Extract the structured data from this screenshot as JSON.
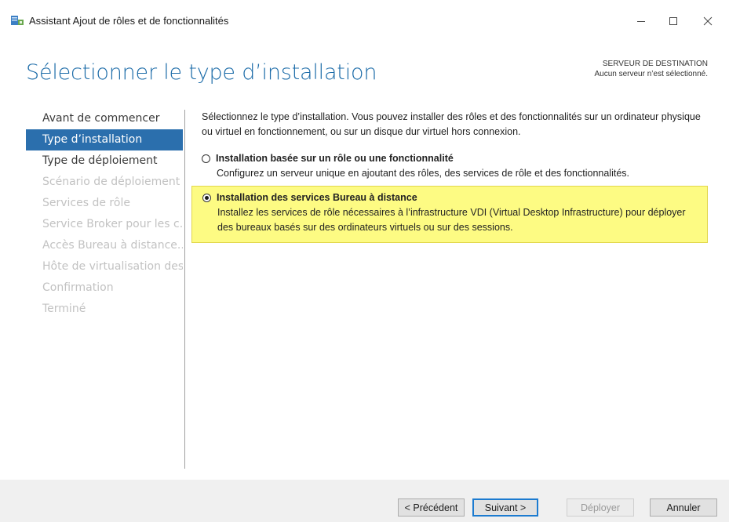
{
  "window": {
    "title": "Assistant Ajout de rôles et de fonctionnalités",
    "controls": [
      "minimize-icon",
      "maximize-icon",
      "close-icon"
    ]
  },
  "page": {
    "title": "Sélectionner le type d’installation",
    "destination_label": "SERVEUR DE DESTINATION",
    "destination_value": "Aucun serveur n’est sélectionné."
  },
  "nav": {
    "items": [
      {
        "label": "Avant de commencer",
        "state": "normal"
      },
      {
        "label": "Type d’installation",
        "state": "active"
      },
      {
        "label": "Type de déploiement",
        "state": "normal"
      },
      {
        "label": "Scénario de déploiement",
        "state": "disabled"
      },
      {
        "label": "Services de rôle",
        "state": "disabled"
      },
      {
        "label": "Service Broker pour les c...",
        "state": "disabled"
      },
      {
        "label": "Accès Bureau à distance...",
        "state": "disabled"
      },
      {
        "label": "Hôte de virtualisation des...",
        "state": "disabled"
      },
      {
        "label": "Confirmation",
        "state": "disabled"
      },
      {
        "label": "Terminé",
        "state": "disabled"
      }
    ]
  },
  "main": {
    "intro": "Sélectionnez le type d’installation. Vous pouvez installer des rôles et des fonctionnalités sur un ordinateur physique ou virtuel en fonctionnement, ou sur un disque dur virtuel hors connexion.",
    "options": [
      {
        "label": "Installation basée sur un rôle ou une fonctionnalité",
        "description": "Configurez un serveur unique en ajoutant des rôles, des services de rôle et des fonctionnalités.",
        "selected": false
      },
      {
        "label": "Installation des services Bureau à distance",
        "description": "Installez les services de rôle nécessaires à l’infrastructure VDI (Virtual Desktop Infrastructure) pour déployer des bureaux basés sur des ordinateurs virtuels ou sur des sessions.",
        "selected": true
      }
    ]
  },
  "footer": {
    "previous_label": "< Précédent",
    "next_label": "Suivant >",
    "deploy_label": "Déployer",
    "cancel_label": "Annuler"
  },
  "colors": {
    "accent": "#2b6fad",
    "title": "#1b6ba8",
    "highlight": "#fdfb83"
  }
}
